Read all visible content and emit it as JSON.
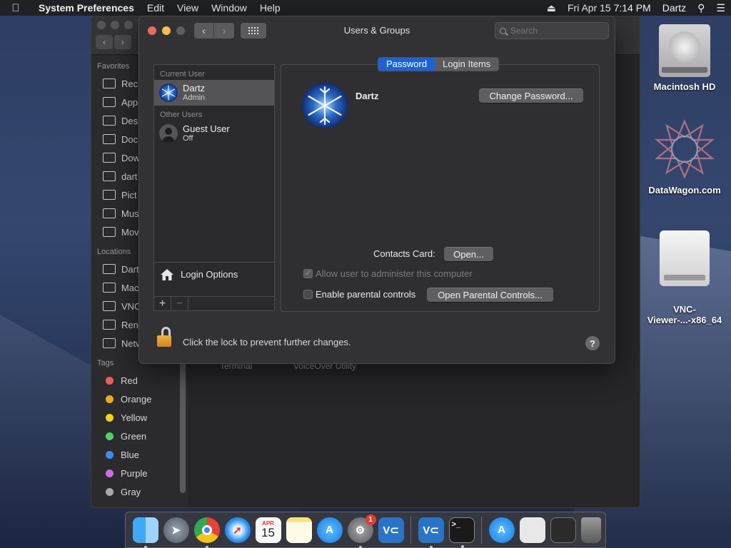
{
  "menubar": {
    "app": "System Preferences",
    "items": [
      "Edit",
      "View",
      "Window",
      "Help"
    ],
    "datetime": "Fri Apr 15  7:14 PM",
    "user": "Dartz"
  },
  "finder": {
    "favorites_header": "Favorites",
    "favorites": [
      "Rec",
      "App",
      "Des",
      "Doc",
      "Dow",
      "dart",
      "Pict",
      "Mus",
      "Mov"
    ],
    "locations_header": "Locations",
    "locations": [
      "Dart",
      "Mac",
      "VNC",
      "Ren",
      "Netw"
    ],
    "tags_header": "Tags",
    "tags": [
      {
        "label": "Red",
        "color": "#ec5f59"
      },
      {
        "label": "Orange",
        "color": "#f5a623"
      },
      {
        "label": "Yellow",
        "color": "#f2d21f"
      },
      {
        "label": "Green",
        "color": "#4cd464"
      },
      {
        "label": "Blue",
        "color": "#3a8ef2"
      },
      {
        "label": "Purple",
        "color": "#c86ee0"
      },
      {
        "label": "Gray",
        "color": "#a8a8a8"
      }
    ],
    "main_items": [
      "Terminal",
      "VoiceOver Utility"
    ]
  },
  "window": {
    "title": "Users & Groups",
    "search_placeholder": "Search",
    "current_user_header": "Current User",
    "other_users_header": "Other Users",
    "users": [
      {
        "name": "Dartz",
        "role": "Admin"
      },
      {
        "name": "Guest User",
        "role": "Off"
      }
    ],
    "login_options": "Login Options",
    "add_label": "+",
    "remove_label": "−",
    "tabs": [
      "Password",
      "Login Items"
    ],
    "selected_user": "Dartz",
    "change_password": "Change Password...",
    "contacts_card_label": "Contacts Card:",
    "open_button": "Open...",
    "allow_admin_label": "Allow user to administer this computer",
    "parental_label": "Enable parental controls",
    "open_parental_button": "Open Parental Controls...",
    "lock_text": "Click the lock to prevent further changes.",
    "help": "?"
  },
  "desktop": {
    "icons": [
      "Macintosh HD",
      "DataWagon.com",
      "VNC-\nViewer-...-x86_64"
    ]
  },
  "dock": {
    "calendar_month": "APR",
    "calendar_day": "15",
    "sysprefs_badge": "1"
  }
}
